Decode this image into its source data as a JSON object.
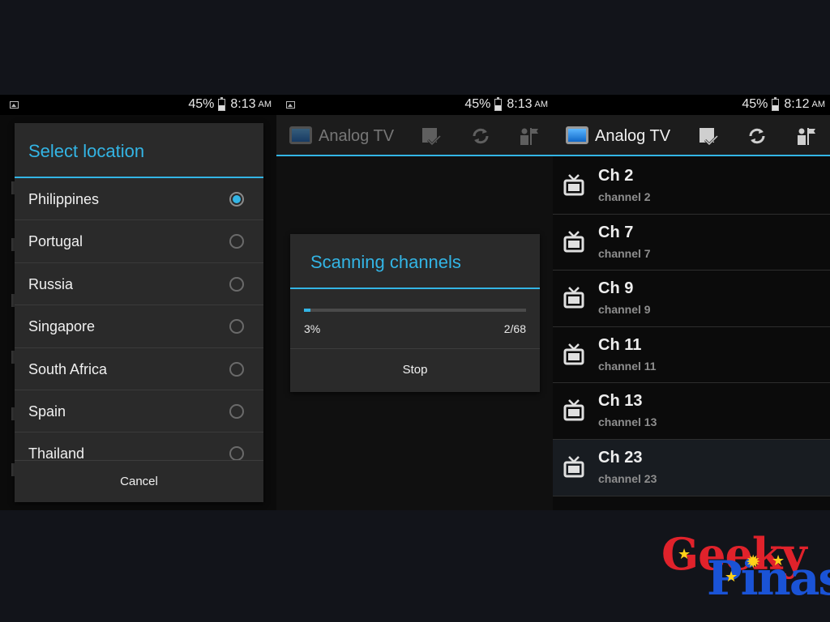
{
  "statusbars": [
    {
      "battery": "45%",
      "time": "8:13",
      "ampm": "AM"
    },
    {
      "battery": "45%",
      "time": "8:13",
      "ampm": "AM"
    },
    {
      "battery": "45%",
      "time": "8:12",
      "ampm": "AM"
    }
  ],
  "battery_level": 0.45,
  "app": {
    "title": "Analog TV"
  },
  "location_dialog": {
    "title": "Select location",
    "selected": "Philippines",
    "options": [
      "Philippines",
      "Portugal",
      "Russia",
      "Singapore",
      "South Africa",
      "Spain",
      "Thailand"
    ],
    "cancel_label": "Cancel"
  },
  "scan_dialog": {
    "title": "Scanning channels",
    "progress_fraction": 0.03,
    "percent_label": "3%",
    "count_label": "2/68",
    "stop_label": "Stop"
  },
  "channels": [
    {
      "title": "Ch 2",
      "subtitle": "channel 2"
    },
    {
      "title": "Ch 7",
      "subtitle": "channel 7"
    },
    {
      "title": "Ch 9",
      "subtitle": "channel 9"
    },
    {
      "title": "Ch 11",
      "subtitle": "channel 11"
    },
    {
      "title": "Ch 13",
      "subtitle": "channel 13"
    },
    {
      "title": "Ch 23",
      "subtitle": "channel 23"
    }
  ],
  "colors": {
    "accent": "#33b5e5",
    "logo_red": "#e0222b",
    "logo_blue": "#1a53d6",
    "logo_star": "#ffd21a"
  },
  "icons": [
    "image-icon",
    "battery-icon",
    "tv-icon",
    "checklist-icon",
    "refresh-icon",
    "settings-flag-icon",
    "radio-button-icon",
    "star-icon",
    "sun-icon"
  ],
  "logo": {
    "word1": "Geeky",
    "word2": "Pinas"
  }
}
